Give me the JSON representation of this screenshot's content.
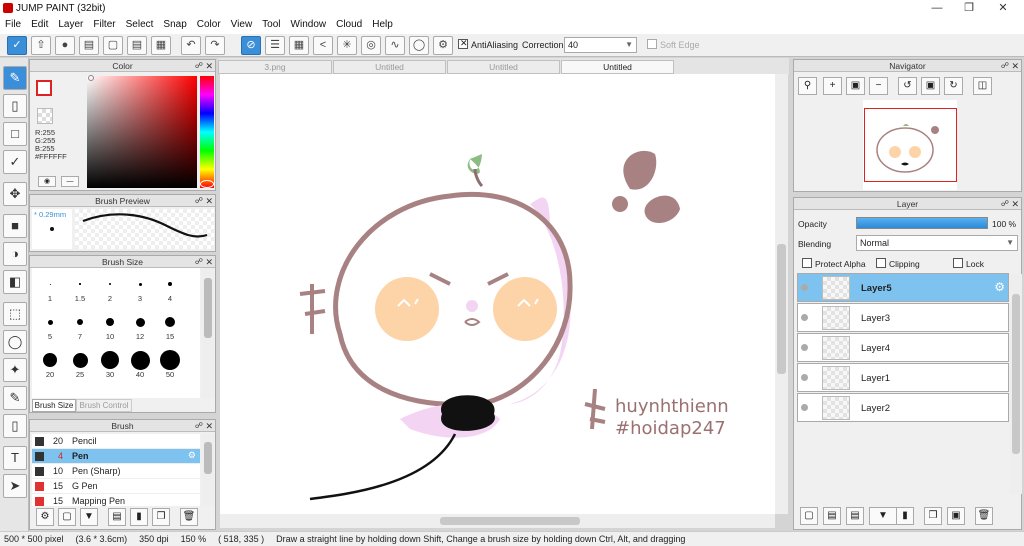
{
  "app": {
    "title": "JUMP PAINT (32bit)"
  },
  "menu": [
    "File",
    "Edit",
    "Layer",
    "Filter",
    "Select",
    "Snap",
    "Color",
    "View",
    "Tool",
    "Window",
    "Cloud",
    "Help"
  ],
  "toolbar": {
    "antialias_label": "AntiAliasing",
    "correction_label": "Correction",
    "correction_value": "40",
    "softedge_label": "Soft Edge"
  },
  "color_panel": {
    "title": "Color",
    "r": "R:255",
    "g": "G:255",
    "b": "B:255",
    "hex": "#FFFFFF"
  },
  "brush_preview": {
    "title": "Brush Preview",
    "size": "* 0.29mm"
  },
  "brush_size": {
    "title": "Brush Size",
    "sizes": [
      "1",
      "1.5",
      "2",
      "3",
      "4",
      "5",
      "7",
      "10",
      "12",
      "15",
      "20",
      "25",
      "30",
      "40",
      "50"
    ],
    "tab_active": "Brush Size",
    "tab_inactive": "Brush Control"
  },
  "brush_panel": {
    "title": "Brush",
    "items": [
      {
        "size": "20",
        "name": "Pencil",
        "color": "#333333"
      },
      {
        "size": "4",
        "name": "Pen",
        "color": "#333333",
        "selected": true
      },
      {
        "size": "10",
        "name": "Pen (Sharp)",
        "color": "#333333"
      },
      {
        "size": "15",
        "name": "G Pen",
        "color": "#e03030"
      },
      {
        "size": "15",
        "name": "Mapping Pen",
        "color": "#e03030"
      }
    ]
  },
  "tabs": [
    {
      "label": "3.png",
      "active": false
    },
    {
      "label": "Untitled",
      "active": false
    },
    {
      "label": "Untitled",
      "active": false
    },
    {
      "label": "Untitled",
      "active": true
    }
  ],
  "artwork": {
    "line1": "huynhthienn",
    "line2": "#hoidap247"
  },
  "navigator": {
    "title": "Navigator"
  },
  "layer_panel": {
    "title": "Layer",
    "opacity_label": "Opacity",
    "opacity_value": "100 %",
    "opacity_fraction": 1.0,
    "blending_label": "Blending",
    "blending_value": "Normal",
    "protect_alpha": "Protect Alpha",
    "clipping": "Clipping",
    "lock": "Lock",
    "layers": [
      "Layer5",
      "Layer3",
      "Layer4",
      "Layer1",
      "Layer2"
    ],
    "selected": "Layer5"
  },
  "status": {
    "size": "500 * 500 pixel",
    "cm": "(3.6 * 3.6cm)",
    "dpi": "350 dpi",
    "zoom": "150 %",
    "coords": "( 518, 335 )",
    "hint": "Draw a straight line by holding down Shift, Change a brush size by holding down Ctrl, Alt, and dragging"
  }
}
